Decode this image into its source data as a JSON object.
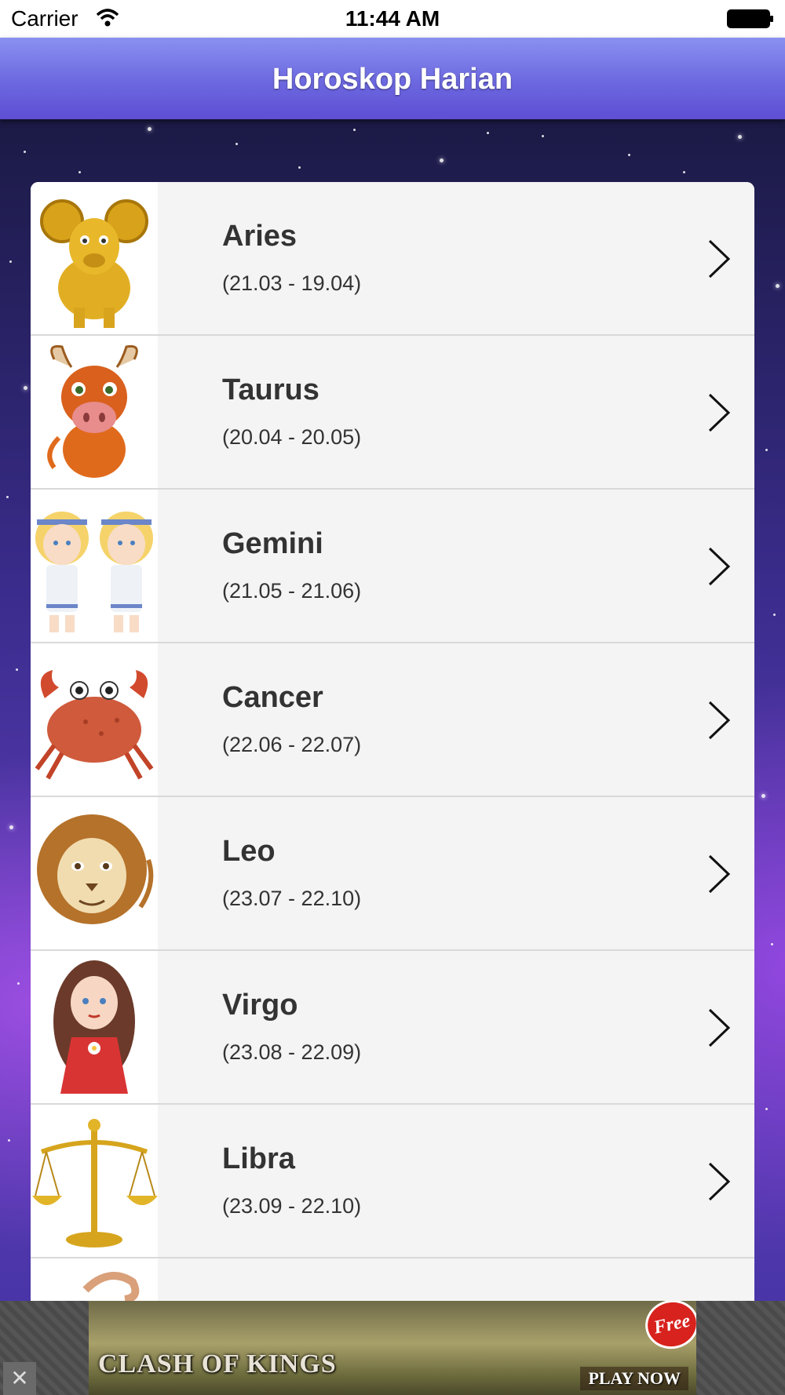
{
  "status_bar": {
    "carrier": "Carrier",
    "time": "11:44 AM"
  },
  "nav": {
    "title": "Horoskop Harian"
  },
  "signs": [
    {
      "name": "Aries",
      "dates": "(21.03 - 19.04)",
      "icon": "ram-icon"
    },
    {
      "name": "Taurus",
      "dates": "(20.04 - 20.05)",
      "icon": "bull-icon"
    },
    {
      "name": "Gemini",
      "dates": "(21.05 - 21.06)",
      "icon": "twins-icon"
    },
    {
      "name": "Cancer",
      "dates": "(22.06 - 22.07)",
      "icon": "crab-icon"
    },
    {
      "name": "Leo",
      "dates": "(23.07 - 22.10)",
      "icon": "lion-icon"
    },
    {
      "name": "Virgo",
      "dates": "(23.08 - 22.09)",
      "icon": "maiden-icon"
    },
    {
      "name": "Libra",
      "dates": "(23.09 - 22.10)",
      "icon": "scales-icon"
    }
  ],
  "ad": {
    "brand": "CLASH OF KINGS",
    "badge": "Free",
    "cta": "PLAY NOW",
    "close": "✕"
  },
  "colors": {
    "nav_gradient_top": "#8a90f0",
    "nav_gradient_bottom": "#5e4ed3",
    "row_background": "#f4f4f4",
    "text": "#333333"
  }
}
